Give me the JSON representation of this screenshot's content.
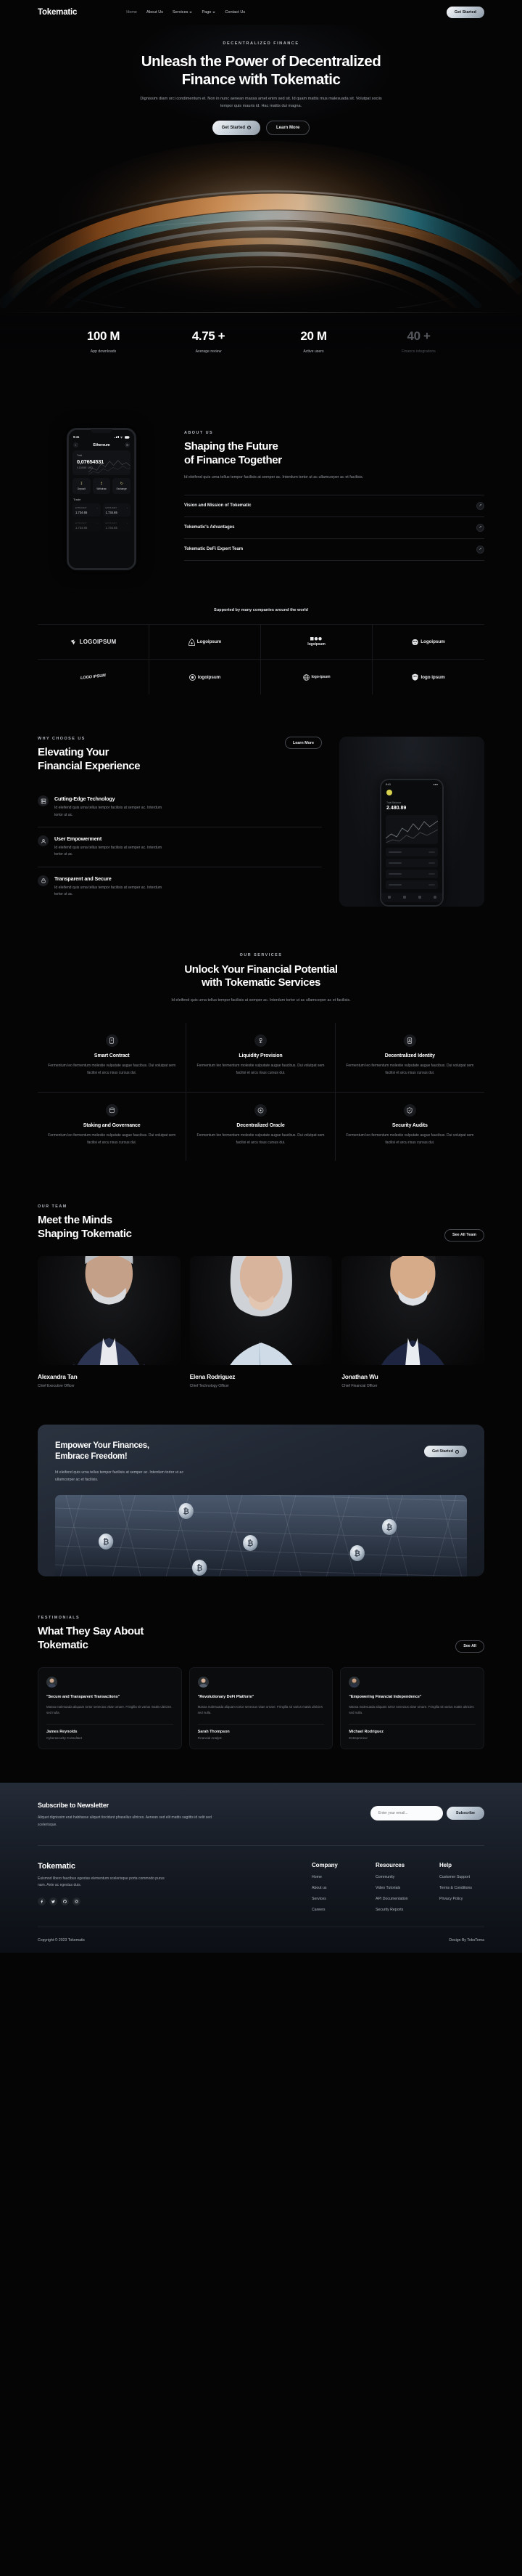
{
  "brand": "Tokematic",
  "nav": {
    "links": [
      {
        "label": "Home",
        "caret": false,
        "active": true
      },
      {
        "label": "About Us",
        "caret": false,
        "active": false
      },
      {
        "label": "Services",
        "caret": true,
        "active": false
      },
      {
        "label": "Page",
        "caret": true,
        "active": false
      },
      {
        "label": "Contact Us",
        "caret": false,
        "active": false
      }
    ],
    "cta": "Get Started"
  },
  "hero": {
    "eyebrow": "DECENTRALIZED FINANCE",
    "title_line1": "Unleash the Power of Decentralized",
    "title_line2": "Finance with Tokematic",
    "paragraph": "Dignissim diam orci condimentum et. Non in nunc aenean massa amet enim sed sit. Id quam mattis mus malesuada sit. Volutpat sociis tempor quis mauris id. Hac mattis dui magna.",
    "btn_primary": "Get Started",
    "btn_secondary": "Learn More"
  },
  "stats": [
    {
      "value": "100 M",
      "label": "App downloads",
      "dim": false
    },
    {
      "value": "4.75 +",
      "label": "Average review",
      "dim": false
    },
    {
      "value": "20 M",
      "label": "Active users",
      "dim": false
    },
    {
      "value": "40 +",
      "label": "Finance integrations",
      "dim": true
    }
  ],
  "about": {
    "eyebrow": "ABOUT US",
    "title_line1": "Shaping the Future",
    "title_line2": "of Finance Together",
    "paragraph": "Id eleifend quis urna tellus tempor facilisis at semper ac. Interdum tortor ut ac ullamcorper ac et facilisis.",
    "accordion": [
      {
        "title": "Vision and Mission of Tokematic"
      },
      {
        "title": "Tokematic's Advantages"
      },
      {
        "title": "Tokematic DeFi Expert Team"
      }
    ],
    "phone": {
      "time": "9:41",
      "title": "Ethereum",
      "total_label": "Total",
      "total_value": "0,07654531",
      "usd_value": "0.126549",
      "usd_unit": "USD",
      "actions": [
        {
          "label": "Deposit"
        },
        {
          "label": "Withdraw"
        },
        {
          "label": "Exchange"
        }
      ],
      "trade_label": "Trade",
      "pairs": [
        {
          "pair": "ETH/USDT",
          "price": "1.734.65"
        },
        {
          "pair": "ETH/USDT",
          "price": "1.734.65"
        },
        {
          "pair": "ETH/USDT",
          "price": "1.734.65"
        },
        {
          "pair": "ETH/USDT",
          "price": "1.734.65"
        }
      ]
    }
  },
  "partners": {
    "caption": "Supported by many companies around the world",
    "logos": [
      {
        "name": "LOGOIPSUM",
        "style": "caps",
        "icon": "bird-mark-icon"
      },
      {
        "name": "Logoipsum",
        "style": "normal",
        "icon": "arch-mark-icon"
      },
      {
        "name": "logoipsum",
        "style": "tiny",
        "icon": "dots-mark-icon"
      },
      {
        "name": "Logoipsum",
        "style": "normal",
        "icon": "face-mark-icon"
      },
      {
        "name": "LOGO IPSUM",
        "style": "hand",
        "icon": "hand-mark-icon"
      },
      {
        "name": "logoipsum",
        "style": "normal",
        "icon": "target-mark-icon"
      },
      {
        "name": "logo-ipsum",
        "style": "tiny",
        "icon": "globe-mark-icon"
      },
      {
        "name": "logo ipsum",
        "style": "normal",
        "icon": "shield-mark-icon"
      }
    ]
  },
  "why": {
    "eyebrow": "WHY CHOOSE US",
    "title_line1": "Elevating Your",
    "title_line2": "Financial Experience",
    "learn_more": "Learn More",
    "features": [
      {
        "title": "Cutting-Edge Technology",
        "desc": "Id eleifend quis urna tellus tempor facilisis at semper ac. Interdum tortor ut ac.",
        "icon": "server-icon"
      },
      {
        "title": "User Empowerment",
        "desc": "Id eleifend quis urna tellus tempor facilisis at semper ac. Interdum tortor ut ac.",
        "icon": "user-shield-icon"
      },
      {
        "title": "Transparent and Secure",
        "desc": "Id eleifend quis urna tellus tempor facilisis at semper ac. Interdum tortor ut ac.",
        "icon": "lock-icon"
      }
    ],
    "app": {
      "time": "9:41",
      "balance_label": "Total Balance",
      "balance_value": "2.480.89"
    }
  },
  "services": {
    "eyebrow": "OUR SERVICES",
    "title_line1": "Unlock Your Financial Potential",
    "title_line2": "with Tokematic Services",
    "paragraph": "Id eleifend quis urna tellus tempor facilisis at semper ac. Interdum tortor ut ac ullamcorper ac et facilisis.",
    "items": [
      {
        "title": "Smart Contract",
        "desc": "Fermentum leo fermentum molestie vulputate augue faucibus. Dui volutpat sem facilisi et arcu risus cursus dui.",
        "icon": "contract-icon"
      },
      {
        "title": "Liquidity Provision",
        "desc": "Fermentum leo fermentum molestie vulputate augue faucibus. Dui volutpat sem facilisi et arcu risus cursus dui.",
        "icon": "liquidity-icon"
      },
      {
        "title": "Decentralized Identity",
        "desc": "Fermentum leo fermentum molestie vulputate augue faucibus. Dui volutpat sem facilisi et arcu risus cursus dui.",
        "icon": "identity-icon"
      },
      {
        "title": "Staking and Governance",
        "desc": "Fermentum leo fermentum molestie vulputate augue faucibus. Dui volutpat sem facilisi et arcu risus cursus dui.",
        "icon": "staking-icon"
      },
      {
        "title": "Decentralized Oracle",
        "desc": "Fermentum leo fermentum molestie vulputate augue faucibus. Dui volutpat sem facilisi et arcu risus cursus dui.",
        "icon": "oracle-icon"
      },
      {
        "title": "Security Audits",
        "desc": "Fermentum leo fermentum molestie vulputate augue faucibus. Dui volutpat sem facilisi et arcu risus cursus dui.",
        "icon": "audit-icon"
      }
    ]
  },
  "team": {
    "eyebrow": "OUR TEAM",
    "title_line1": "Meet the Minds",
    "title_line2": "Shaping Tokematic",
    "see_all": "See All Team",
    "members": [
      {
        "name": "Alexandra Tan",
        "role": "Chief Executive Officer"
      },
      {
        "name": "Elena Rodriguez",
        "role": "Chief Technology Officer"
      },
      {
        "name": "Jonathan Wu",
        "role": "Chief Financial Officer"
      }
    ]
  },
  "cta": {
    "title_line1": "Empower Your Finances,",
    "title_line2": "Embrace Freedom!",
    "paragraph": "Id eleifend quis urna tellus tempor facilisis at semper ac. Interdum tortor ut ac ullamcorper ac et facilisis.",
    "button": "Get Started"
  },
  "testimonials": {
    "eyebrow": "TESTIMONIALS",
    "title_line1": "What They Say About",
    "title_line2": "Tokematic",
    "see_all": "See All",
    "items": [
      {
        "quote": "\"Secure and Transparent Transactions\"",
        "body": "Massa malesuada aliquam tortor senectus vitae ornare. Fringilla sit varius mattis ultricies sed nulla.",
        "name": "James Reynolds",
        "role": "Cybersecurity Consultant"
      },
      {
        "quote": "\"Revolutionary DeFi Platform\"",
        "body": "Massa malesuada aliquam tortor senectus vitae ornare. Fringilla sit varius mattis ultricies sed nulla.",
        "name": "Sarah Thompson",
        "role": "Financial Analyst"
      },
      {
        "quote": "\"Empowering Financial Independence\"",
        "body": "Massa malesuada aliquam tortor senectus vitae ornare. Fringilla sit varius mattis ultricies sed nulla.",
        "name": "Michael Rodriguez",
        "role": "Entrepreneur"
      }
    ]
  },
  "newsletter": {
    "title": "Subscribe to Newsletter",
    "paragraph": "Aliquet dignissim erat habitasse aliquet tincidunt phasellus ultrices. Aenean sed elit mattis sagittis id velit sed scelerisque.",
    "placeholder": "Enter your email...",
    "button": "Subscribe"
  },
  "footer": {
    "brand": "Tokematic",
    "about": "Euismod libero faucibus egestas elementum scelerisque porta commodo purus nam. Ante ac egestas duis.",
    "socials": [
      "facebook-icon",
      "twitter-icon",
      "github-icon",
      "instagram-icon"
    ],
    "columns": [
      {
        "title": "Company",
        "links": [
          "Home",
          "About us",
          "Services",
          "Careers"
        ]
      },
      {
        "title": "Resources",
        "links": [
          "Community",
          "Video Tutorials",
          "API Documentation",
          "Security Reports"
        ]
      },
      {
        "title": "Help",
        "links": [
          "Customer Support",
          "Terms & Conditions",
          "Privacy Policy"
        ]
      }
    ],
    "copyright": "Copyright © 2023 Tokematic",
    "credit": "Design By TokoTema"
  },
  "colors": {
    "background": "#050506",
    "accent_metal": "#c9d2da",
    "hero_orange": "#e08b42",
    "hero_teal": "#2fb6c9",
    "footer_top": "#252c38"
  }
}
